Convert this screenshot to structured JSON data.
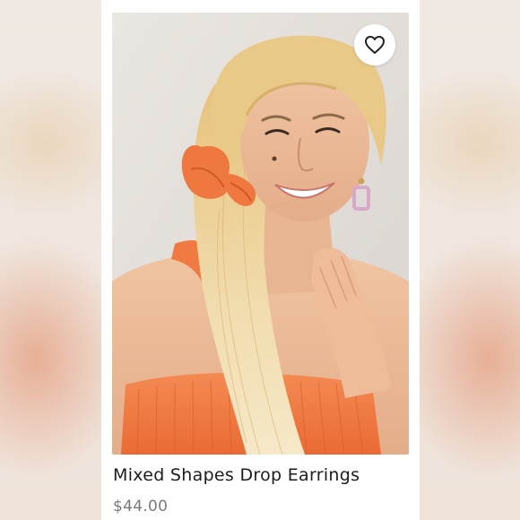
{
  "listing": {
    "title": "Mixed Shapes Drop Earrings",
    "price": "$44.00",
    "image_alt": "Model with long blonde hair wearing an orange top, orange hair bow and drop earrings",
    "favorite_icon": "heart-outline-icon"
  },
  "colors": {
    "card_background": "#ffffff",
    "title_text": "#1c1c1c",
    "price_text": "#7a7a7a",
    "garment": "#f0773f",
    "hair": "#ecd091"
  }
}
